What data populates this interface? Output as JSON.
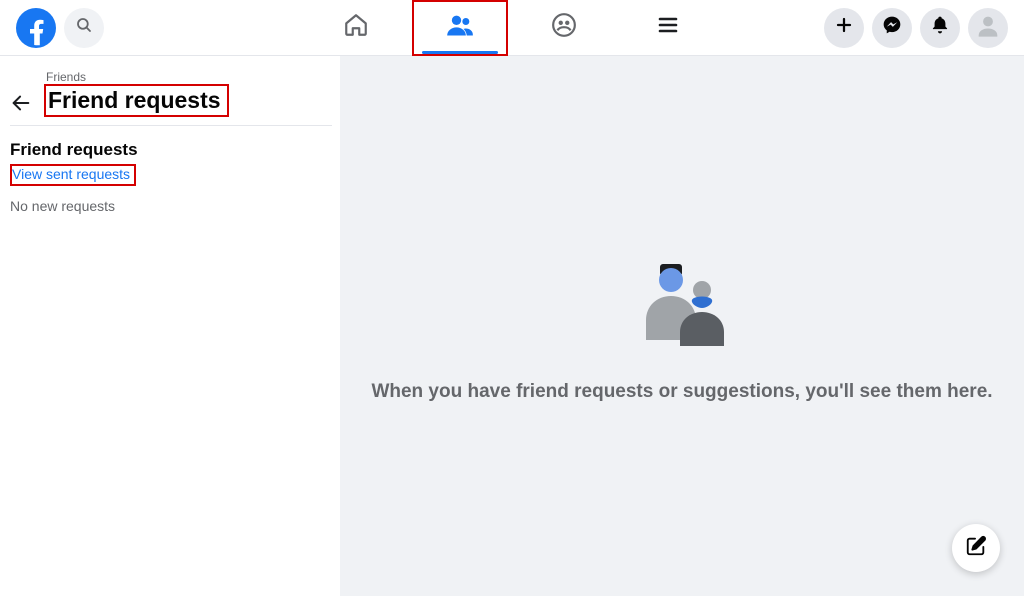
{
  "header": {
    "nav": {
      "home": "home",
      "friends": "friends",
      "groups": "groups",
      "menu": "menu"
    },
    "right": {
      "create": "create",
      "messenger": "messenger",
      "notifications": "notifications",
      "account": "account"
    }
  },
  "sidebar": {
    "breadcrumb": "Friends",
    "title": "Friend requests",
    "section_title": "Friend requests",
    "view_sent_label": "View sent requests",
    "empty_text": "No new requests"
  },
  "main": {
    "empty_message": "When you have friend requests or suggestions, you'll see them here."
  },
  "fab": {
    "label": "compose"
  },
  "highlights": {
    "friends_tab": true,
    "title": true,
    "view_sent": true
  }
}
